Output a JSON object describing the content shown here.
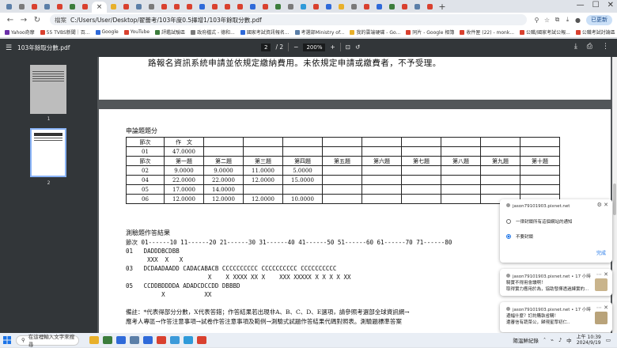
{
  "browser": {
    "tab_favicon_colors": [
      "#5b7fa8",
      "#7a7a7a",
      "#d9412f",
      "#5b7fa8",
      "#d9412f",
      "#3c7d3c",
      "#d9412f",
      "#e8b02a",
      "#d9412f",
      "#5b7fa8",
      "#7a7a7a",
      "#d9412f",
      "#d9412f",
      "#d9412f",
      "#2f6ad9",
      "#d9412f",
      "#d9412f",
      "#d9412f",
      "#2f6ad9",
      "#d9412f",
      "#3c7d3c",
      "#7a7a7a",
      "#2f9ad9",
      "#d9412f",
      "#2f6ad9",
      "#e8b02a",
      "#7a7a7a",
      "#d9412f",
      "#2f6ad9",
      "#3c7d3c",
      "#d9412f",
      "#5b7fa8",
      "#d9412f"
    ],
    "active_tab_close": "×",
    "new_tab": "+",
    "address": {
      "chip": "檔案",
      "path": "C:/Users/User/Desktop/翟蕾考/103年度0.5擇增1/103年餘取分數.pdf"
    },
    "update_button": "已更新",
    "bookmarks": [
      {
        "label": "Yahoo奇摩",
        "color": "#6b2fa8"
      },
      {
        "label": "55 TVBS新聞｜百...",
        "color": "#d9412f"
      },
      {
        "label": "Google",
        "color": "#2f6ad9"
      },
      {
        "label": "YouTube",
        "color": "#d9412f"
      },
      {
        "label": "評鑑試驗區",
        "color": "#3c7d3c"
      },
      {
        "label": "政府檔式 - 德和...",
        "color": "#7a7a7a"
      },
      {
        "label": "國家考試資訊報名...",
        "color": "#2f6ad9"
      },
      {
        "label": "考選部Ministry of...",
        "color": "#5b7fa8"
      },
      {
        "label": "我的雲端硬碟 - Go...",
        "color": "#e8b02a"
      },
      {
        "label": "同片 - Google 相簿",
        "color": "#d9412f"
      },
      {
        "label": "收件匣 (22) - monk...",
        "color": "#d9412f"
      },
      {
        "label": "公職/國家考試公報...",
        "color": "#d9412f"
      },
      {
        "label": "公職考試討論區 ...",
        "color": "#d9412f"
      }
    ],
    "all_bookmarks": "所有書籤"
  },
  "pdf": {
    "title": "103年餘取分數.pdf",
    "page_current": "2",
    "page_total": "/ 2",
    "zoom": "200%",
    "zoom_minus": "−",
    "zoom_plus": "+",
    "thumbs": [
      "1",
      "2"
    ],
    "page1_text": "路報名資訊系統申請並依規定繳納費用。未依規定申請或繳費者，不予受理。",
    "table_heading": "申論題題分",
    "table_rows": [
      [
        "節次",
        "作　文",
        "",
        "",
        "",
        "",
        "",
        "",
        "",
        "",
        ""
      ],
      [
        "01",
        "47.0000",
        "",
        "",
        "",
        "",
        "",
        "",
        "",
        "",
        ""
      ],
      [
        "節次",
        "第一題",
        "第二題",
        "第三題",
        "第四題",
        "第五題",
        "第六題",
        "第七題",
        "第八題",
        "第九題",
        "第十題"
      ],
      [
        "02",
        "9.0000",
        "9.0000",
        "11.0000",
        "5.0000",
        "",
        "",
        "",
        "",
        "",
        ""
      ],
      [
        "04",
        "22.0000",
        "22.0000",
        "12.0000",
        "15.0000",
        "",
        "",
        "",
        "",
        "",
        ""
      ],
      [
        "05",
        "17.0000",
        "14.0000",
        "",
        "",
        "",
        "",
        "",
        "",
        "",
        ""
      ],
      [
        "06",
        "12.0000",
        "12.0000",
        "12.0000",
        "10.0000",
        "",
        "",
        "",
        "",
        "",
        ""
      ]
    ],
    "test_heading": "測驗題作答結果",
    "test_lines": [
      "節次 01------10 11------20 21------30 31------40 41------50 51------60 61------70 71------80",
      "01   DADDDBCDBB",
      "      XXX  X   X",
      "03   DCDAADAADD CADACABACB CCCCCCCCCC CCCCCCCCCC CCCCCCCCCC",
      "                       X    X XXXX XX X    XXX XXXXX X X X X XX",
      "05   CCDDBDDDDA ADADCDCCDD DBBBD",
      "          X           XX"
    ],
    "note_1": "備註：*代表得部分分數，X代表答錯；作答結果若出現非A、B、C、D、E選項，請參照考選部全球資訊網→",
    "note_2": "應考人專區→作答注意事項→試卷作答注意事項及範例→測驗式試題作答結果代碼對照表。測驗題標準答案"
  },
  "notifications": [
    {
      "sender": "jason79101903.pixnet.net",
      "options": [
        "一律封鎖所有這個網站的通知",
        "不要封鎖"
      ],
      "selected": 1,
      "done": "完成"
    },
    {
      "sender": "jason79101903.pixnet.net • 17 小時",
      "body_1": "騎實不得用會讀啊！",
      "body_2": "取得實力應用於為，協助發揮透過練實的..."
    },
    {
      "sender": "jason79101903.pixnet.net • 17 小時",
      "body_1": "邊幅什麼？訂約購執省購！",
      "body_2": "遭審信有蔬菜公，歸現星眾初仁.."
    }
  ],
  "taskbar": {
    "search_placeholder": "在這裡輸入文字來搜尋",
    "app_colors": [
      "#e8b02a",
      "#3c7d3c",
      "#2f6ad9",
      "#5b7fa8",
      "#2f6ad9",
      "#d9412f",
      "#3c9ad9",
      "#2f9ad9",
      "#d9412f"
    ],
    "tray_text": "陽溫鮮紀錄",
    "ime": "中",
    "time": "上午 10:39",
    "date": "2024/9/19"
  }
}
